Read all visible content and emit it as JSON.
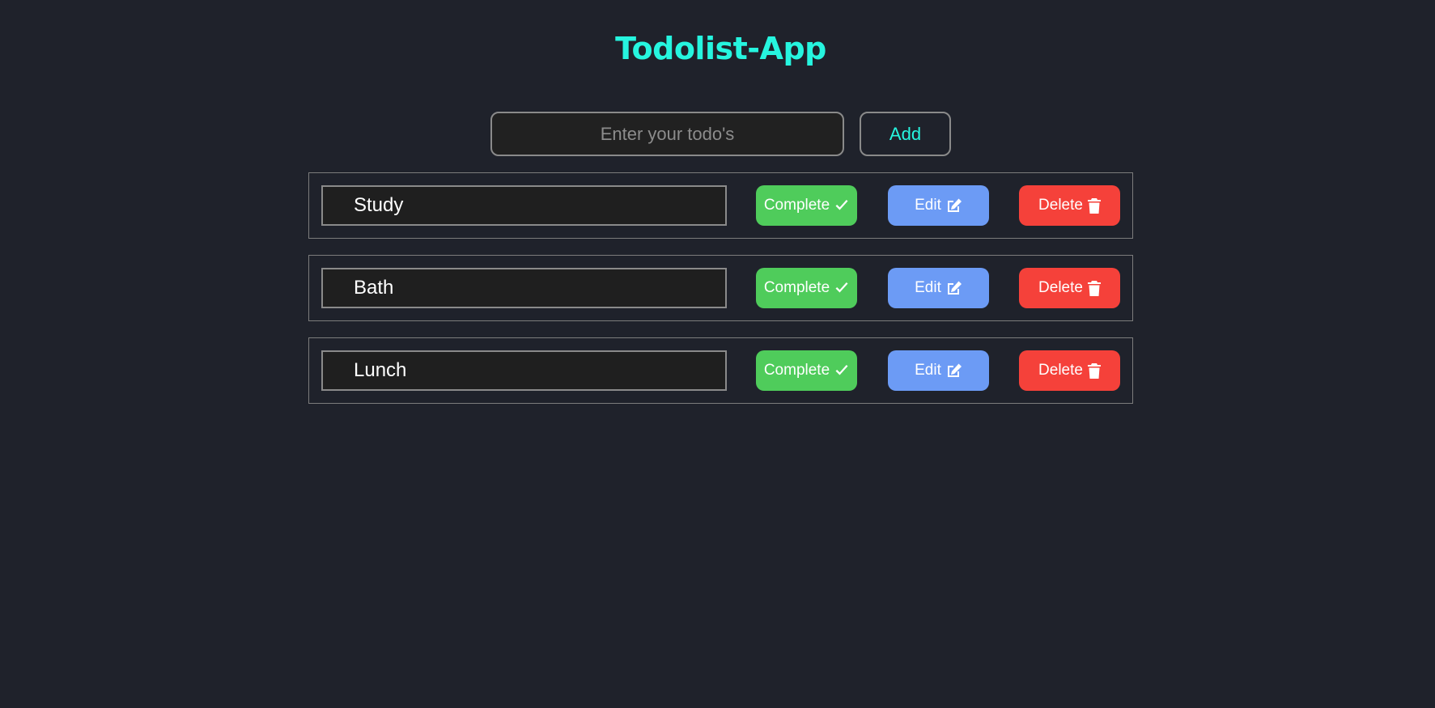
{
  "app": {
    "title": "Todolist-App"
  },
  "input": {
    "placeholder": "Enter your todo's",
    "value": ""
  },
  "add_button": {
    "label": "Add"
  },
  "todos": [
    {
      "text": "Study",
      "complete_label": "Complete",
      "edit_label": "Edit",
      "delete_label": "Delete"
    },
    {
      "text": "Bath",
      "complete_label": "Complete",
      "edit_label": "Edit",
      "delete_label": "Delete"
    },
    {
      "text": "Lunch",
      "complete_label": "Complete",
      "edit_label": "Edit",
      "delete_label": "Delete"
    }
  ],
  "icons": {
    "complete": "check-icon",
    "edit": "edit-icon",
    "delete": "trash-icon"
  },
  "colors": {
    "background": "#1f222b",
    "accent": "#26f5df",
    "complete": "#4fcc5b",
    "edit": "#6c9bf5",
    "delete": "#f5413a"
  }
}
